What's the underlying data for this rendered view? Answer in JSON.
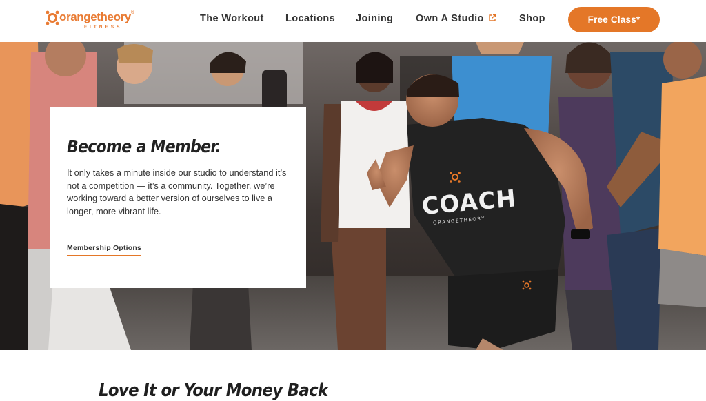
{
  "brand": {
    "name": "orangetheory",
    "registered": "®",
    "sub": "FITNESS",
    "color": "#e47728"
  },
  "nav": {
    "items": [
      {
        "label": "The Workout"
      },
      {
        "label": "Locations"
      },
      {
        "label": "Joining"
      },
      {
        "label": "Own A Studio",
        "icon": "external-link-icon"
      },
      {
        "label": "Shop"
      }
    ],
    "cta_label": "Free Class*"
  },
  "hero": {
    "image_alt": "Coach leading a group fitness class",
    "shirt_text": "COACH",
    "shirt_sub": "ORANGETHEORY",
    "card": {
      "title": "Become a Member.",
      "body": "It only takes a minute inside our studio to understand it’s not a competition — it’s a community. Together, we’re working toward a better version of ourselves to live a longer, more vibrant life.",
      "link_label": "Membership Options"
    }
  },
  "section": {
    "title": "Love It or Your Money Back"
  }
}
